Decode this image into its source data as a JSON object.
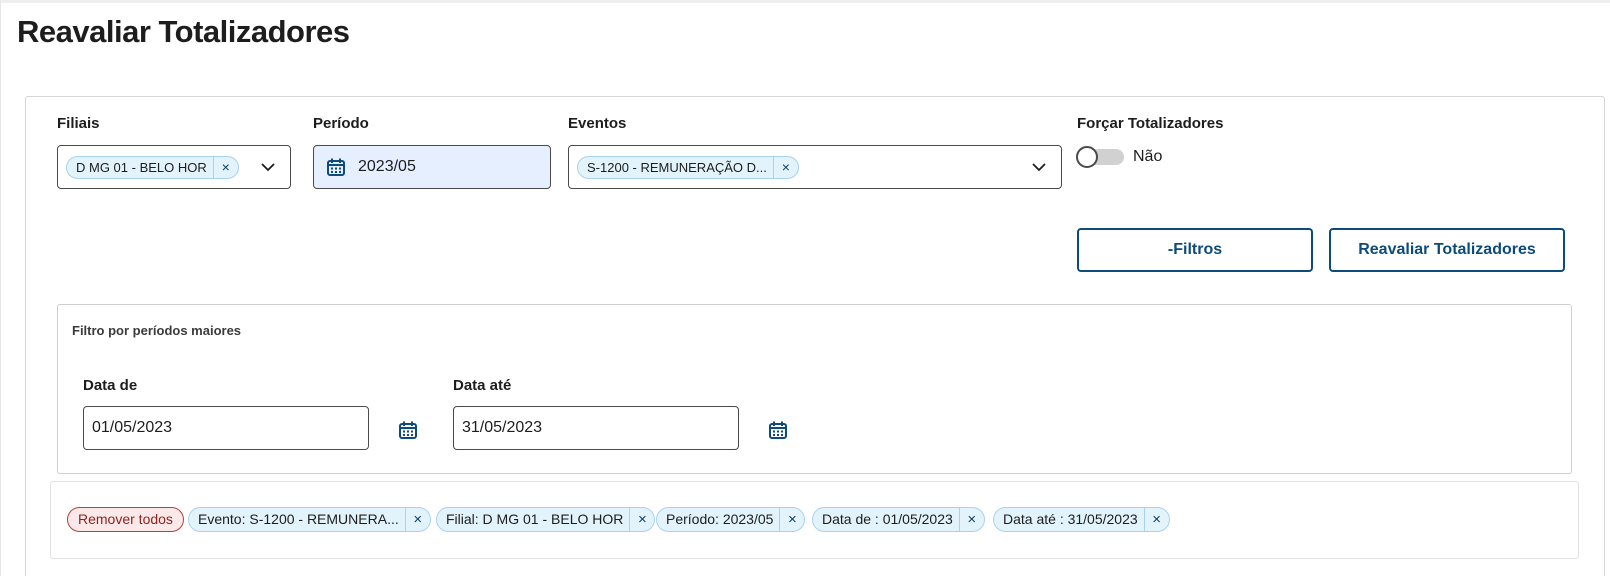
{
  "page": {
    "title": "Reavaliar Totalizadores"
  },
  "form": {
    "filiais": {
      "label": "Filiais",
      "chip": "D MG 01 - BELO HOR"
    },
    "periodo": {
      "label": "Período",
      "value": "2023/05"
    },
    "eventos": {
      "label": "Eventos",
      "chip": "S-1200 - REMUNERAÇÃO D..."
    },
    "forcar": {
      "label": "Forçar Totalizadores",
      "state_label": "Não",
      "checked": false
    }
  },
  "buttons": {
    "filtros_label": "-Filtros",
    "reavaliar_label": "Reavaliar Totalizadores"
  },
  "filtro_periodos": {
    "title": "Filtro por períodos maiores",
    "data_de": {
      "label": "Data de",
      "value": "01/05/2023"
    },
    "data_ate": {
      "label": "Data até",
      "value": "31/05/2023"
    }
  },
  "tags": {
    "remove_all": "Remover todos",
    "items": [
      "Evento: S-1200 - REMUNERA...",
      "Filial: D MG 01 - BELO HOR",
      "Período: 2023/05",
      "Data de : 01/05/2023",
      "Data até : 31/05/2023"
    ]
  },
  "colors": {
    "primary": "#0c4b7a",
    "chip_bg": "#e3f3fc",
    "chip_border": "#a8d3ec",
    "remove_bg": "#fbe9e9",
    "remove_border": "#b0413e"
  },
  "icons": {
    "close": "×",
    "dropdown": "chevron-down-icon",
    "calendar": "calendar-icon"
  }
}
